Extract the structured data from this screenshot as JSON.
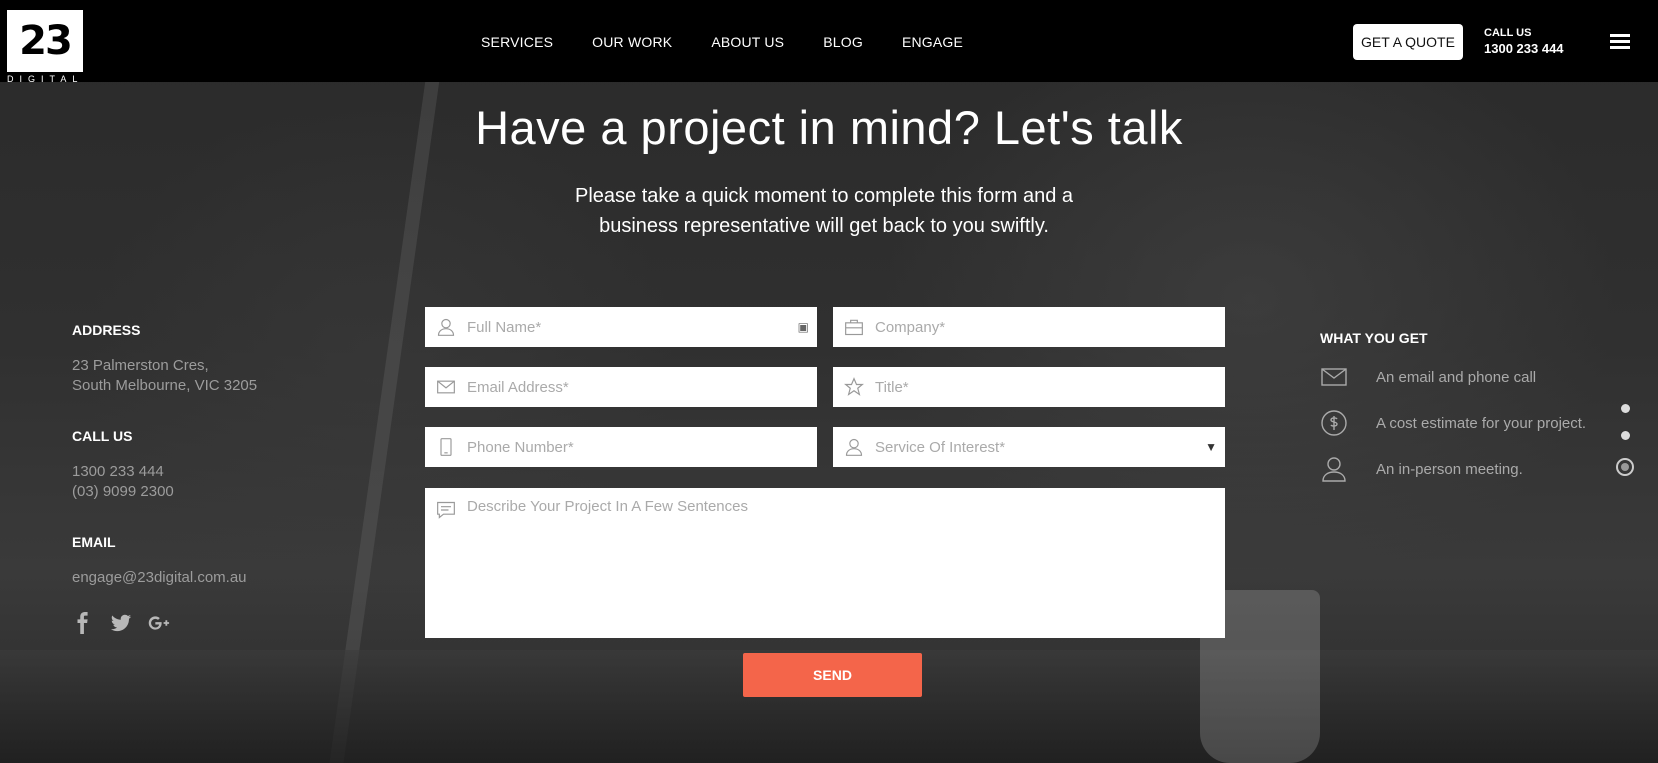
{
  "header": {
    "logo_text": "23",
    "logo_sub": "DIGITAL",
    "nav": [
      "SERVICES",
      "OUR WORK",
      "ABOUT US",
      "BLOG",
      "ENGAGE"
    ],
    "quote_button": "GET A QUOTE",
    "call_label": "CALL US",
    "call_number": "1300 233 444"
  },
  "hero": {
    "title": "Have a project in mind? Let's talk",
    "subtitle": "Please take a quick moment to complete this form and a business representative will get back to you swiftly."
  },
  "contact": {
    "address_heading": "ADDRESS",
    "address_line1": "23 Palmerston Cres,",
    "address_line2": "South Melbourne, VIC 3205",
    "call_heading": "CALL US",
    "phone1": "1300 233 444",
    "phone2": "(03) 9099 2300",
    "email_heading": "EMAIL",
    "email": "engage@23digital.com.au",
    "social": [
      "facebook-icon",
      "twitter-icon",
      "google-plus-icon"
    ]
  },
  "form": {
    "full_name_placeholder": "Full Name*",
    "company_placeholder": "Company*",
    "email_placeholder": "Email Address*",
    "title_placeholder": "Title*",
    "phone_placeholder": "Phone Number*",
    "service_placeholder": "Service Of Interest*",
    "service_arrow": "▼",
    "description_placeholder": "Describe Your Project In A Few Sentences",
    "send_label": "SEND"
  },
  "what_you_get": {
    "heading": "WHAT YOU GET",
    "items": [
      {
        "icon": "envelope-icon",
        "label": "An email and phone call"
      },
      {
        "icon": "dollar-icon",
        "label": "A cost estimate for your project."
      },
      {
        "icon": "person-icon",
        "label": "An in-person meeting."
      }
    ]
  },
  "colors": {
    "accent": "#f4654a",
    "header_bg": "#000000"
  }
}
